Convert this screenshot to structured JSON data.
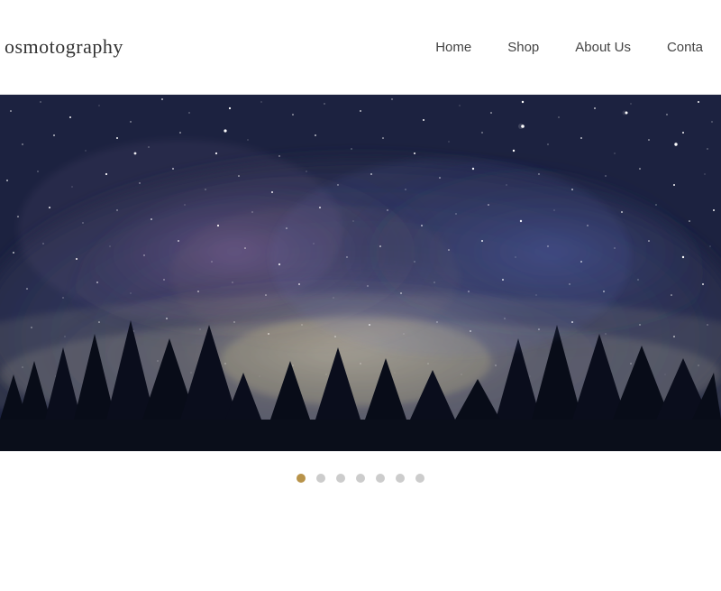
{
  "header": {
    "logo": "osmotography",
    "nav": {
      "items": [
        {
          "label": "Home",
          "id": "home"
        },
        {
          "label": "Shop",
          "id": "shop"
        },
        {
          "label": "About Us",
          "id": "about"
        },
        {
          "label": "Conta",
          "id": "contact"
        }
      ]
    }
  },
  "hero": {
    "alt": "Milky Way galaxy night sky photograph"
  },
  "pagination": {
    "dots": [
      {
        "id": 1,
        "active": true
      },
      {
        "id": 2,
        "active": false
      },
      {
        "id": 3,
        "active": false
      },
      {
        "id": 4,
        "active": false
      },
      {
        "id": 5,
        "active": false
      },
      {
        "id": 6,
        "active": false
      },
      {
        "id": 7,
        "active": false
      }
    ]
  },
  "colors": {
    "active_dot": "#b8934a",
    "inactive_dot": "#cccccc",
    "nav_text": "#444444",
    "logo_text": "#333333"
  }
}
